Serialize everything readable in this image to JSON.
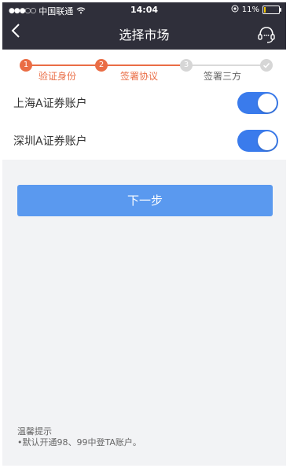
{
  "status_bar": {
    "carrier": "中国联通",
    "time": "14:04",
    "battery": "11%"
  },
  "nav": {
    "title": "选择市场",
    "icons": [
      "back-arrow-icon",
      "customer-service-icon"
    ]
  },
  "steps": {
    "items": [
      {
        "number": "1",
        "label": "验证身份",
        "state": "done"
      },
      {
        "number": "2",
        "label": "签署协议",
        "state": "current"
      },
      {
        "number": "3",
        "label": "签署三方",
        "state": "upcoming"
      },
      {
        "number": "",
        "label": "",
        "state": "final-check"
      }
    ]
  },
  "accounts": [
    {
      "label": "上海A证券账户",
      "enabled": true
    },
    {
      "label": "深圳A证券账户",
      "enabled": true
    }
  ],
  "next_button": {
    "label": "下一步"
  },
  "tips": {
    "title": "温馨提示",
    "text": "•默认开通98、99中登TA账户。"
  },
  "colors": {
    "header_bg": "#2f2f3a",
    "accent_orange": "#ea6d45",
    "toggle_blue": "#3a7bec",
    "button_blue": "#5a99ef"
  }
}
